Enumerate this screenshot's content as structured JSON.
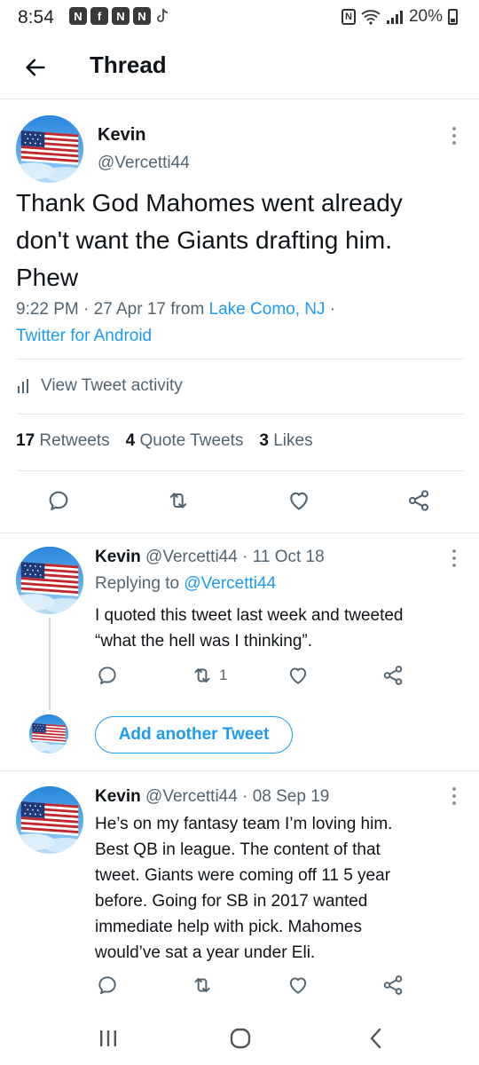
{
  "status_bar": {
    "time": "8:54",
    "battery": "20%",
    "nfc": "N",
    "notif_icons": [
      "N",
      "f",
      "N",
      "N"
    ]
  },
  "header": {
    "title": "Thread",
    "back_icon": "arrow-left-icon"
  },
  "main_tweet": {
    "author_name": "Kevin",
    "handle": "@Vercetti44",
    "text_lines": [
      "Thank God Mahomes went already",
      "don't want the Giants drafting him.",
      "Phew"
    ],
    "meta_time": "9:22 PM · 27 Apr 17 from ",
    "location": "Lake Como, NJ",
    "meta_sep": " ·",
    "client": "Twitter for Android",
    "activity_label": "View Tweet activity",
    "stats": {
      "retweets_count": "17",
      "retweets_label": "Retweets",
      "quotes_count": "4",
      "quotes_label": "Quote Tweets",
      "likes_count": "3",
      "likes_label": "Likes"
    }
  },
  "reply1": {
    "author_name": "Kevin",
    "handle_date": "@Vercetti44 · 11 Oct 18",
    "replying_prefix": "Replying to ",
    "replying_to": "@Vercetti44",
    "text_lines": [
      "I quoted this tweet last week and tweeted",
      "“what the hell was I thinking”."
    ],
    "retweet_count": "1"
  },
  "add_tweet": {
    "label": "Add another Tweet"
  },
  "reply2": {
    "author_name": "Kevin",
    "handle_date": "@Vercetti44 · 08 Sep 19",
    "text_lines": [
      "He’s on my fantasy team I’m loving him.",
      "Best QB in league. The content of that",
      "tweet. Giants were coming off 11 5 year",
      "before. Going for SB in 2017 wanted",
      "immediate help with pick. Mahomes",
      "would’ve sat a year under Eli."
    ]
  },
  "colors": {
    "accent": "#1d9bf0",
    "text": "#0f1419",
    "muted": "#536471",
    "divider": "#e6e9eb"
  }
}
